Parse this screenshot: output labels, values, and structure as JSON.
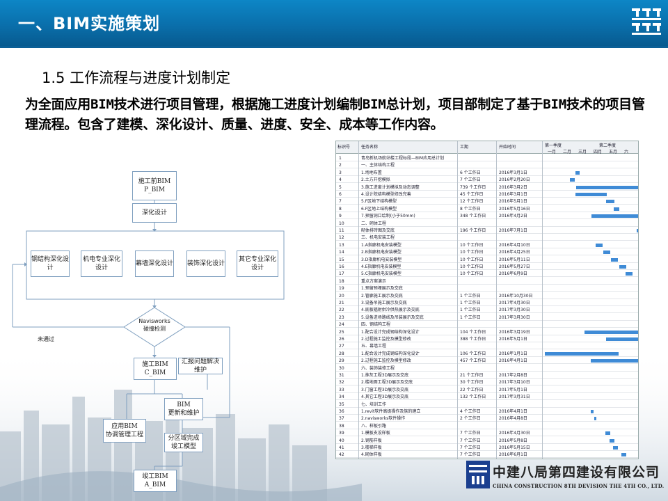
{
  "header": {
    "title": "一、BIM实施策划"
  },
  "section": {
    "subtitle": "1.5 工作流程与进度计划制定"
  },
  "body_text": "为全面应用BIM技术进行项目管理，根据施工进度计划编制BIM总计划，项目部制定了基于BIM技术的项目管理流程。包含了建模、深化设计、质量、进度、安全、成本等工作内容。",
  "flowchart": {
    "start_line1": "施工前BIM",
    "start_line2": "P_BIM",
    "deepen": "深化设计",
    "subs": [
      "钢结构深化设计",
      "机电专业深化设计",
      "幕墙深化设计",
      "装饰深化设计",
      "其它专业深化设计"
    ],
    "decision_line1": "Navisworks",
    "decision_line2": "碰撞检测",
    "fail_label": "未通过",
    "construct_line1": "施工BIM",
    "construct_line2": "C_BIM",
    "summary": "汇报问题解决维护",
    "update_line1": "BIM",
    "update_line2": "更新和维护",
    "apply_line1": "应用BIM",
    "apply_line2": "协调管理工程",
    "complete_line1": "分区域完成",
    "complete_line2": "竣工模型",
    "final_line1": "竣工BIM",
    "final_line2": "A_BIM"
  },
  "gantt": {
    "headers": {
      "id": "标识号",
      "name": "任务名称",
      "duration": "工期",
      "start": "开始时间",
      "q1": "第一季度",
      "q2": "第二季度"
    },
    "months": [
      "一月",
      "二月",
      "三月",
      "四月",
      "五月",
      "六"
    ],
    "rows": [
      {
        "id": "1",
        "name": "青岛新机场航站楼工程标段—BIM应用总计划",
        "duration": "",
        "start": ""
      },
      {
        "id": "2",
        "name": "一、主体结构工程",
        "duration": "",
        "start": ""
      },
      {
        "id": "3",
        "name": "1.场地布置",
        "duration": "6 个工作日",
        "start": "2016年3月1日"
      },
      {
        "id": "4",
        "name": "2.土方开挖模拟",
        "duration": "7 个工作日",
        "start": "2016年2月20日"
      },
      {
        "id": "5",
        "name": "3.施工进度计划模拟及动态调整",
        "duration": "739 个工作日",
        "start": "2016年3月2日"
      },
      {
        "id": "6",
        "name": "4.设计院结构模型修改完善",
        "duration": "45 个工作日",
        "start": "2016年3月1日"
      },
      {
        "id": "7",
        "name": "5.F区地下结构模型",
        "duration": "12 个工作日",
        "start": "2016年5月1日"
      },
      {
        "id": "8",
        "name": "6.F区地上结构模型",
        "duration": "8 个工作日",
        "start": "2016年5月16日"
      },
      {
        "id": "9",
        "name": "7.预留洞口绘制(小于50mm)",
        "duration": "348 个工作日",
        "start": "2016年4月2日"
      },
      {
        "id": "10",
        "name": "二、砌体工程",
        "duration": "",
        "start": ""
      },
      {
        "id": "11",
        "name": "砌体排砖图及交底",
        "duration": "196 个工作日",
        "start": "2016年7月1日"
      },
      {
        "id": "12",
        "name": "三、机电安装工程",
        "duration": "",
        "start": ""
      },
      {
        "id": "13",
        "name": "1.A指廊机电安装模型",
        "duration": "10 个工作日",
        "start": "2016年4月10日"
      },
      {
        "id": "14",
        "name": "2.B指廊机电安装模型",
        "duration": "10 个工作日",
        "start": "2016年4月25日"
      },
      {
        "id": "15",
        "name": "3.D指廊机电安装模型",
        "duration": "10 个工作日",
        "start": "2016年5月11日"
      },
      {
        "id": "16",
        "name": "4.E指廊机电安装模型",
        "duration": "10 个工作日",
        "start": "2016年5月27日"
      },
      {
        "id": "17",
        "name": "5.C指廊机电安装模型",
        "duration": "10 个工作日",
        "start": "2016年6月9日"
      },
      {
        "id": "18",
        "name": "重点方案演示",
        "duration": "",
        "start": ""
      },
      {
        "id": "19",
        "name": "1.预留预埋展示及交底",
        "duration": "",
        "start": ""
      },
      {
        "id": "20",
        "name": "2.管廊施工展示及交底",
        "duration": "1 个工作日",
        "start": "2016年10月30日"
      },
      {
        "id": "21",
        "name": "3.设备吊施工展示及交底",
        "duration": "1 个工作日",
        "start": "2017年4月30日"
      },
      {
        "id": "22",
        "name": "4.底板辐射供冷供热展示及交底",
        "duration": "1 个工作日",
        "start": "2017年3月30日"
      },
      {
        "id": "23",
        "name": "5.设备进场路线及吊装展示及交底",
        "duration": "1 个工作日",
        "start": "2017年3月30日"
      },
      {
        "id": "24",
        "name": "四、钢结构工程",
        "duration": "",
        "start": ""
      },
      {
        "id": "25",
        "name": "1.配合设计完成钢结构深化设计",
        "duration": "104 个工作日",
        "start": "2016年3月19日"
      },
      {
        "id": "26",
        "name": "2.过程施工监控及模型修改",
        "duration": "388 个工作日",
        "start": "2016年5月1日"
      },
      {
        "id": "27",
        "name": "五、幕墙工程",
        "duration": "",
        "start": ""
      },
      {
        "id": "28",
        "name": "1.配合设计完成钢结构深化设计",
        "duration": "106 个工作日",
        "start": "2016年1月1日"
      },
      {
        "id": "29",
        "name": "2.过程施工监控及模型修改",
        "duration": "457 个工作日",
        "start": "2016年4月1日"
      },
      {
        "id": "30",
        "name": "六、装饰装修工程",
        "duration": "",
        "start": ""
      },
      {
        "id": "31",
        "name": "1.抹灰工程3D展示及交底",
        "duration": "21 个工作日",
        "start": "2017年2月8日"
      },
      {
        "id": "32",
        "name": "2.楼地面工程3D展示及交底",
        "duration": "30 个工作日",
        "start": "2017年3月10日"
      },
      {
        "id": "33",
        "name": "3.门窗工程3D展示及交底",
        "duration": "22 个工作日",
        "start": "2017年5月1日"
      },
      {
        "id": "34",
        "name": "4.其它工程3D展示及交底",
        "duration": "132 个工作日",
        "start": "2017年3月31日"
      },
      {
        "id": "35",
        "name": "七、培训工作",
        "duration": "",
        "start": ""
      },
      {
        "id": "36",
        "name": "1.revit软件高级操作及族的建立",
        "duration": "4 个工作日",
        "start": "2016年4月1日"
      },
      {
        "id": "37",
        "name": "2.navisworks软件操作",
        "duration": "2 个工作日",
        "start": "2016年4月8日"
      },
      {
        "id": "38",
        "name": "八、样板引路",
        "duration": "",
        "start": ""
      },
      {
        "id": "39",
        "name": "1.模板支设样板",
        "duration": "7 个工作日",
        "start": "2016年4月30日"
      },
      {
        "id": "40",
        "name": "2.钢筋样板",
        "duration": "7 个工作日",
        "start": "2016年5月8日"
      },
      {
        "id": "41",
        "name": "3.楼梯样板",
        "duration": "7 个工作日",
        "start": "2016年5月15日"
      },
      {
        "id": "42",
        "name": "4.砌体样板",
        "duration": "7 个工作日",
        "start": "2016年6月1日"
      }
    ]
  },
  "company": {
    "name": "中建八局第四建设有限公司",
    "english": "CHINA CONSTRUCTION 8TH DEVISION THE 4TH CO., LTD."
  },
  "colors": {
    "header_blue": "#0a6fab",
    "bar_blue": "#3f8bd6"
  }
}
